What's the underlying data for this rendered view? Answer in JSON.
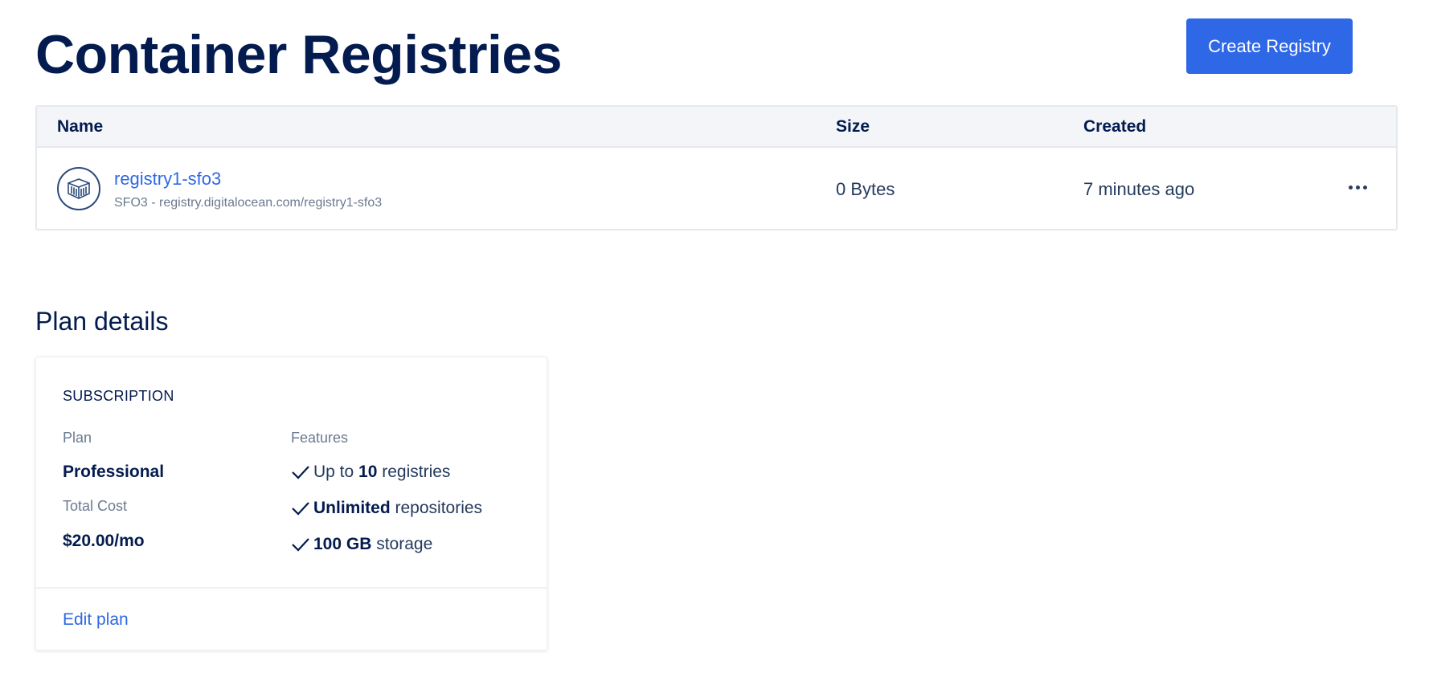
{
  "header": {
    "title": "Container Registries",
    "create_button_label": "Create Registry"
  },
  "colors": {
    "accent": "#2f68e6",
    "heading": "#031b4e",
    "muted": "#6b7a90",
    "table_header_bg": "#f3f5f9"
  },
  "registry_table": {
    "columns": [
      "Name",
      "Size",
      "Created"
    ],
    "rows": [
      {
        "icon": "container-icon",
        "name": "registry1-sfo3",
        "subtitle": "SFO3 - registry.digitalocean.com/registry1-sfo3",
        "size": "0 Bytes",
        "created": "7 minutes ago",
        "actions_icon": "more-options-icon"
      }
    ]
  },
  "plan_details": {
    "section_title": "Plan details",
    "subscription_label": "SUBSCRIPTION",
    "plan_label": "Plan",
    "plan_value": "Professional",
    "total_cost_label": "Total Cost",
    "total_cost_value": "$20.00/mo",
    "features_label": "Features",
    "features": [
      {
        "prefix": "Up to ",
        "bold": "10",
        "suffix": " registries"
      },
      {
        "prefix": "",
        "bold": "Unlimited",
        "suffix": " repositories"
      },
      {
        "prefix": "",
        "bold": "100 GB",
        "suffix": " storage"
      }
    ],
    "edit_link_label": "Edit plan"
  }
}
